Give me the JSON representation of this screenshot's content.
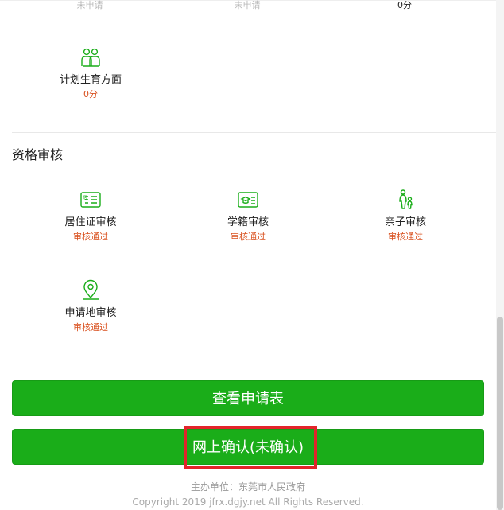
{
  "top_row_status": [
    "未申请",
    "未申请",
    "0分"
  ],
  "family_planning": {
    "label": "计划生育方面",
    "score": "0分"
  },
  "qualification": {
    "title": "资格审核",
    "items": [
      {
        "label": "居住证审核",
        "status": "审核通过",
        "icon": "residence-card-icon"
      },
      {
        "label": "学籍审核",
        "status": "审核通过",
        "icon": "student-status-icon"
      },
      {
        "label": "亲子审核",
        "status": "审核通过",
        "icon": "parent-child-icon"
      },
      {
        "label": "申请地审核",
        "status": "审核通过",
        "icon": "location-pin-icon"
      }
    ]
  },
  "buttons": {
    "view_application": "查看申请表",
    "online_confirm": "网上确认(未确认)"
  },
  "footer": {
    "organizer": "主办单位：东莞市人民政府",
    "copyright": "Copyright 2019 jfrx.dgjy.net All Rights Reserved."
  },
  "colors": {
    "accent_green": "#1aad19",
    "status_orange": "#d9501e",
    "highlight_red": "#e3242b"
  }
}
